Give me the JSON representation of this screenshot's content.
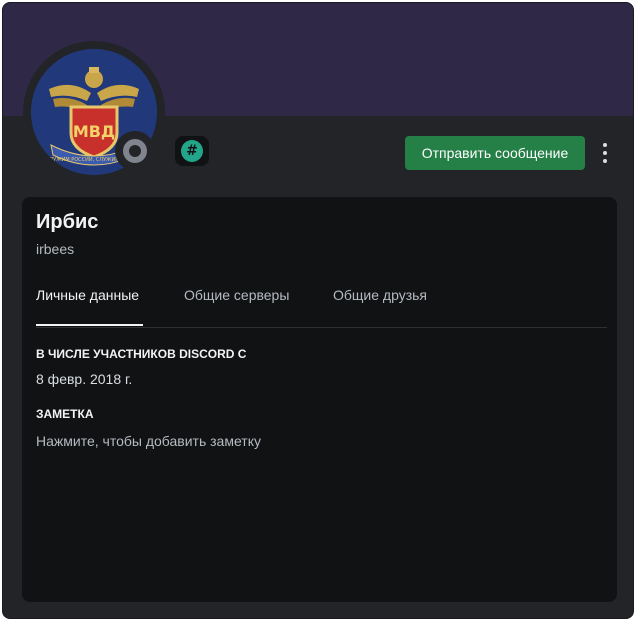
{
  "profile": {
    "display_name": "Ирбис",
    "username": "irbees",
    "avatar_text": "МВД",
    "avatar_ribbon": "СЛУЖИМ РОССИИ, СЛУЖИМ ЗАКОНУ",
    "status": "offline",
    "badge_icon": "hashtag-badge-icon",
    "badge_symbol": "#"
  },
  "actions": {
    "send_message_label": "Отправить сообщение",
    "more_icon": "vertical-ellipsis-icon"
  },
  "tabs": [
    {
      "label": "Личные данные",
      "active": true
    },
    {
      "label": "Общие серверы",
      "active": false
    },
    {
      "label": "Общие друзья",
      "active": false
    }
  ],
  "info": {
    "member_since_heading": "В ЧИСЛЕ УЧАСТНИКОВ DISCORD С",
    "member_since_value": "8 февр. 2018 г.",
    "note_heading": "ЗАМЕТКА",
    "note_placeholder": "Нажмите, чтобы добавить заметку"
  },
  "colors": {
    "banner": "#2f2846",
    "background": "#232428",
    "card": "#111214",
    "primary_button": "#248046",
    "badge": "#23a58a",
    "status_offline": "#80848e"
  }
}
